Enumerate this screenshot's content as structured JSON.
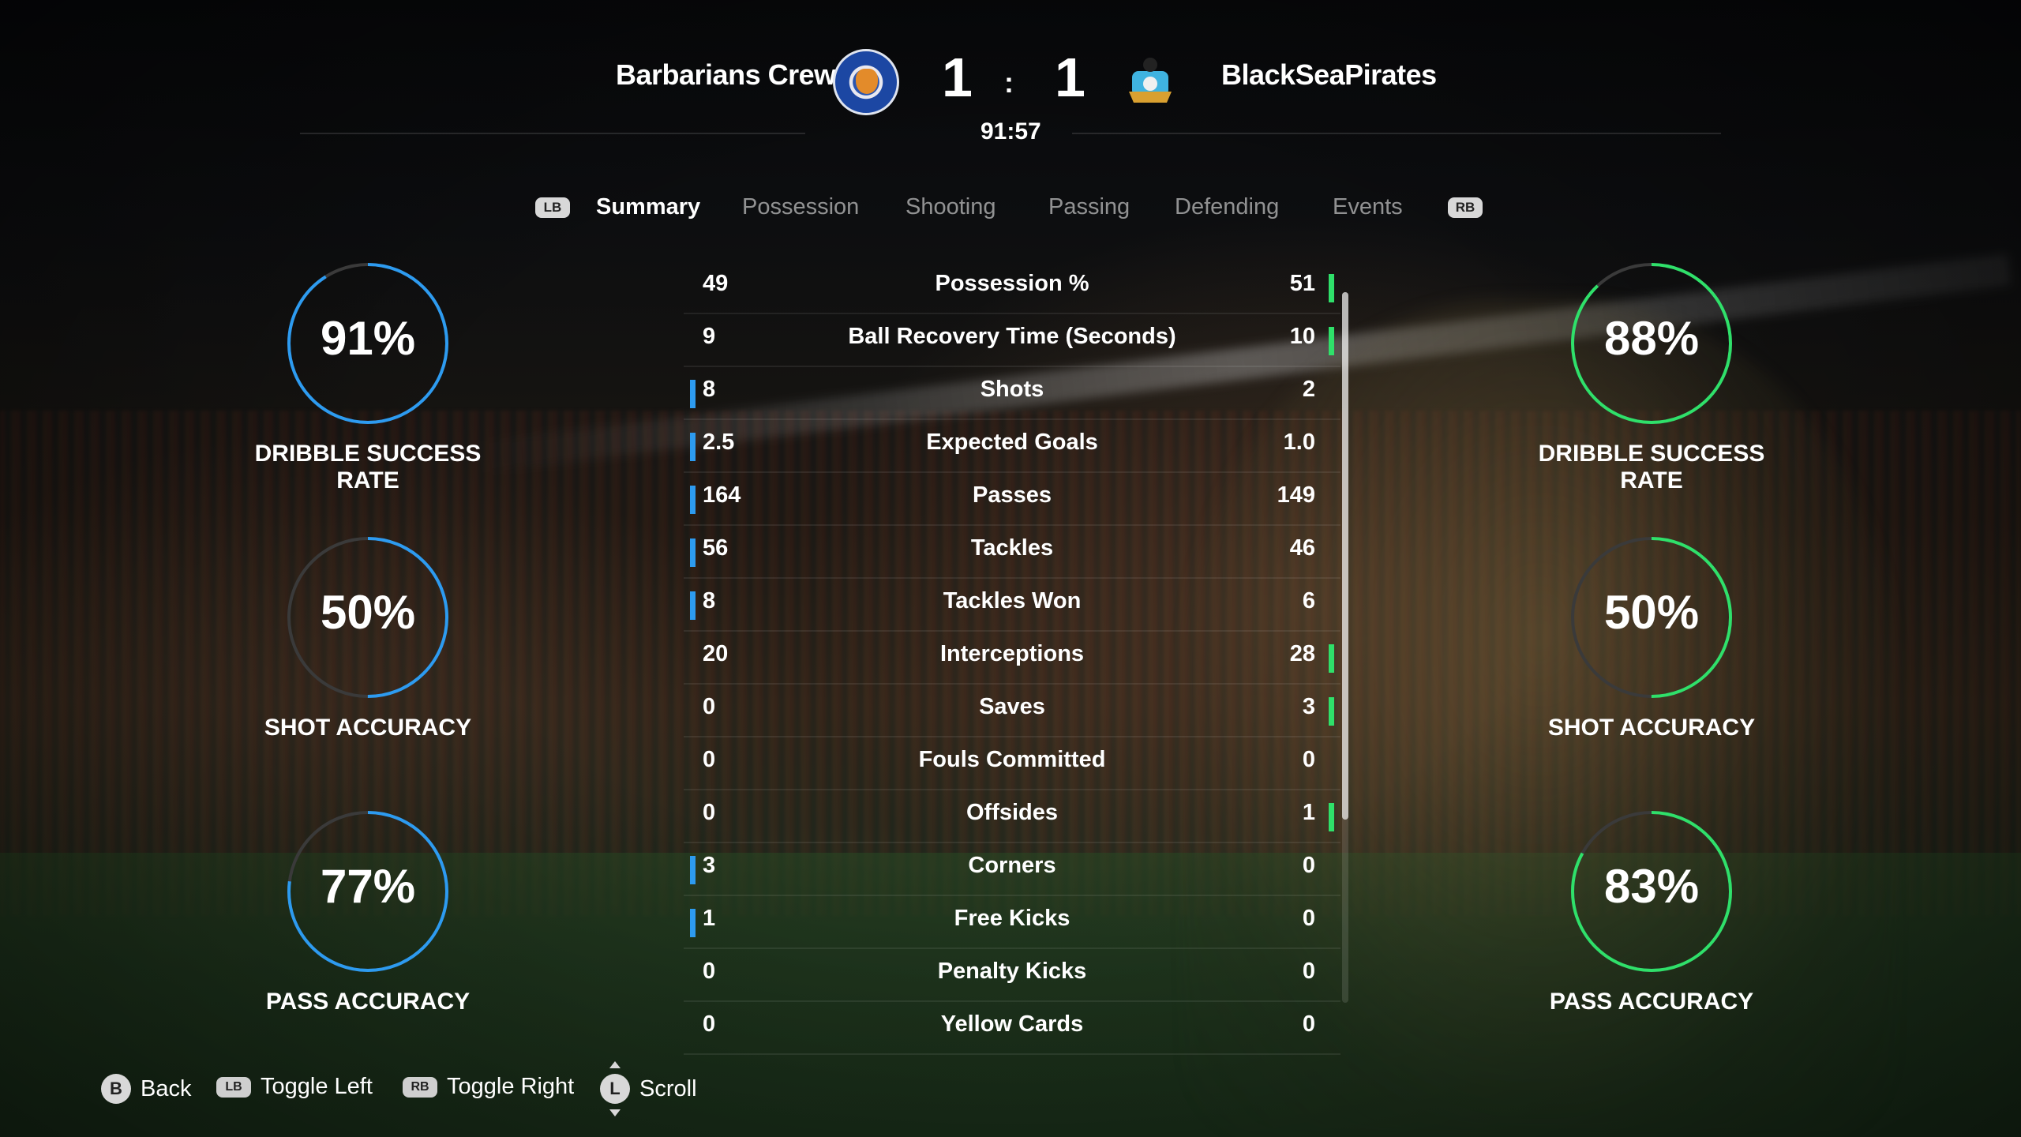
{
  "match": {
    "home_team": "Barbarians Crew",
    "away_team": "BlackSeaPirates",
    "home_score": "1",
    "away_score": "1",
    "separator": ":",
    "clock": "91:57"
  },
  "tabs": {
    "prev_button": "LB",
    "next_button": "RB",
    "items": [
      {
        "label": "Summary",
        "active": true
      },
      {
        "label": "Possession",
        "active": false
      },
      {
        "label": "Shooting",
        "active": false
      },
      {
        "label": "Passing",
        "active": false
      },
      {
        "label": "Defending",
        "active": false
      },
      {
        "label": "Events",
        "active": false
      }
    ]
  },
  "stats": [
    {
      "label": "Possession %",
      "home": "49",
      "away": "51",
      "leader": "away"
    },
    {
      "label": "Ball Recovery Time (Seconds)",
      "home": "9",
      "away": "10",
      "leader": "away"
    },
    {
      "label": "Shots",
      "home": "8",
      "away": "2",
      "leader": "home"
    },
    {
      "label": "Expected Goals",
      "home": "2.5",
      "away": "1.0",
      "leader": "home"
    },
    {
      "label": "Passes",
      "home": "164",
      "away": "149",
      "leader": "home"
    },
    {
      "label": "Tackles",
      "home": "56",
      "away": "46",
      "leader": "home"
    },
    {
      "label": "Tackles Won",
      "home": "8",
      "away": "6",
      "leader": "home"
    },
    {
      "label": "Interceptions",
      "home": "20",
      "away": "28",
      "leader": "away"
    },
    {
      "label": "Saves",
      "home": "0",
      "away": "3",
      "leader": "away"
    },
    {
      "label": "Fouls Committed",
      "home": "0",
      "away": "0",
      "leader": "none"
    },
    {
      "label": "Offsides",
      "home": "0",
      "away": "1",
      "leader": "away"
    },
    {
      "label": "Corners",
      "home": "3",
      "away": "0",
      "leader": "home"
    },
    {
      "label": "Free Kicks",
      "home": "1",
      "away": "0",
      "leader": "home"
    },
    {
      "label": "Penalty Kicks",
      "home": "0",
      "away": "0",
      "leader": "none"
    },
    {
      "label": "Yellow Cards",
      "home": "0",
      "away": "0",
      "leader": "none"
    }
  ],
  "gauges": {
    "home": [
      {
        "pct": "91%",
        "value": 0.91,
        "label": "DRIBBLE SUCCESS RATE"
      },
      {
        "pct": "50%",
        "value": 0.5,
        "label": "SHOT ACCURACY"
      },
      {
        "pct": "77%",
        "value": 0.77,
        "label": "PASS ACCURACY"
      }
    ],
    "away": [
      {
        "pct": "88%",
        "value": 0.88,
        "label": "DRIBBLE SUCCESS RATE"
      },
      {
        "pct": "50%",
        "value": 0.5,
        "label": "SHOT ACCURACY"
      },
      {
        "pct": "83%",
        "value": 0.83,
        "label": "PASS ACCURACY"
      }
    ]
  },
  "footer": {
    "back_button": "B",
    "back_label": "Back",
    "toggle_left_button": "LB",
    "toggle_left_label": "Toggle Left",
    "toggle_right_button": "RB",
    "toggle_right_label": "Toggle Right",
    "scroll_button": "L",
    "scroll_label": "Scroll"
  },
  "colors": {
    "home_accent": "#2d9bf0",
    "away_accent": "#2fe06a",
    "track": "#3a3a3a"
  }
}
